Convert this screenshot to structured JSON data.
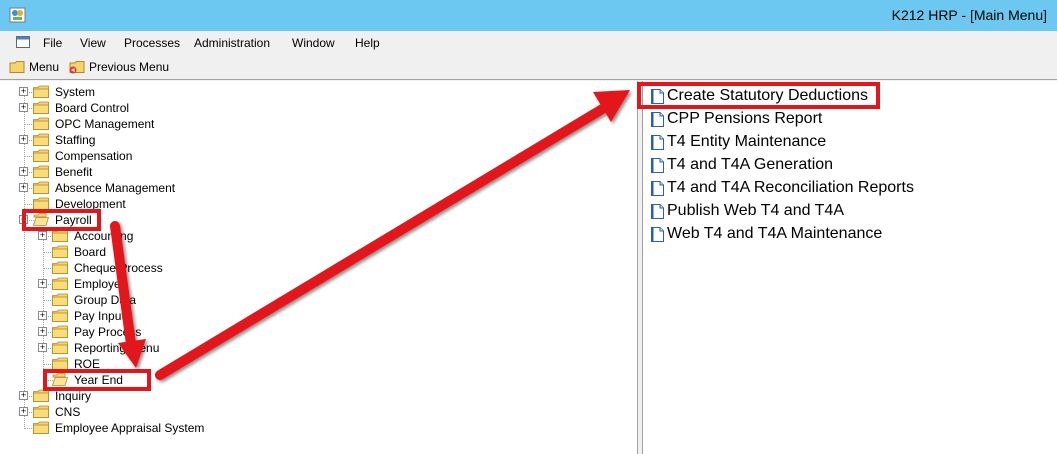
{
  "window": {
    "title": "K212 HRP - [Main Menu]",
    "app_icon": "hrp-app-icon"
  },
  "menubar": {
    "items": [
      "File",
      "View",
      "Processes",
      "Administration",
      "Window",
      "Help"
    ]
  },
  "toolbar": {
    "menu_label": "Menu",
    "previous_menu_label": "Previous Menu"
  },
  "tree": {
    "top": [
      {
        "label": "System",
        "expandable": true
      },
      {
        "label": "Board Control",
        "expandable": true
      },
      {
        "label": "OPC Management",
        "expandable": false
      },
      {
        "label": "Staffing",
        "expandable": true
      },
      {
        "label": "Compensation",
        "expandable": false
      },
      {
        "label": "Benefit",
        "expandable": true
      },
      {
        "label": "Absence Management",
        "expandable": true
      },
      {
        "label": "Development",
        "expandable": false
      },
      {
        "label": "Payroll",
        "expandable": true,
        "expanded": true
      }
    ],
    "payroll_children": [
      {
        "label": "Accounting",
        "expandable": true
      },
      {
        "label": "Board",
        "expandable": false
      },
      {
        "label": "Cheque Process",
        "expandable": false
      },
      {
        "label": "Employee",
        "expandable": true
      },
      {
        "label": "Group Data",
        "expandable": false
      },
      {
        "label": "Pay Inputs",
        "expandable": true
      },
      {
        "label": "Pay Process",
        "expandable": true
      },
      {
        "label": "Reporting Menu",
        "expandable": true
      },
      {
        "label": "ROE",
        "expandable": false
      },
      {
        "label": "Year End",
        "expandable": false,
        "selected": true
      }
    ],
    "bottom": [
      {
        "label": "Inquiry",
        "expandable": true
      },
      {
        "label": "CNS",
        "expandable": true
      },
      {
        "label": "Employee Appraisal System",
        "expandable": false
      }
    ]
  },
  "right_list": {
    "items": [
      "Create Statutory Deductions",
      "CPP Pensions Report",
      "T4 Entity Maintenance",
      "T4 and T4A Generation",
      "T4 and T4A Reconciliation Reports",
      "Publish Web T4 and T4A",
      "Web T4 and T4A Maintenance"
    ]
  },
  "annotation": {
    "color": "#e3161b"
  }
}
